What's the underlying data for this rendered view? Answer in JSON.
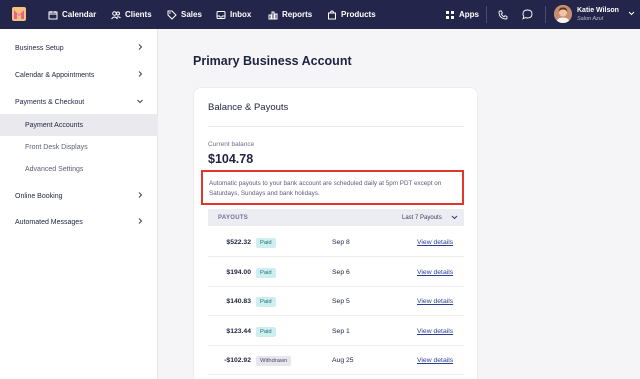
{
  "nav": {
    "items": [
      {
        "label": "Calendar",
        "icon": "calendar-icon"
      },
      {
        "label": "Clients",
        "icon": "clients-icon"
      },
      {
        "label": "Sales",
        "icon": "tag-icon"
      },
      {
        "label": "Inbox",
        "icon": "inbox-icon"
      },
      {
        "label": "Reports",
        "icon": "reports-icon"
      },
      {
        "label": "Products",
        "icon": "bag-icon"
      }
    ],
    "apps_label": "Apps",
    "user_name": "Katie Wilson",
    "user_business": "Salon Azul"
  },
  "sidebar": {
    "items": [
      {
        "label": "Business Setup"
      },
      {
        "label": "Calendar & Appointments"
      },
      {
        "label": "Payments & Checkout"
      },
      {
        "label": "Online Booking"
      },
      {
        "label": "Automated Messages"
      }
    ],
    "subitems": [
      {
        "label": "Payment Accounts"
      },
      {
        "label": "Front Desk Displays"
      },
      {
        "label": "Advanced Settings"
      }
    ]
  },
  "main": {
    "page_title": "Primary Business Account",
    "card_title": "Balance & Payouts",
    "balance_label": "Current balance",
    "balance_value": "$104.78",
    "payout_note": "Automatic payouts to your bank account are scheduled daily at 5pm PDT except on Saturdays, Sundays and bank holidays.",
    "payouts_header": "PAYOUTS",
    "payouts_filter": "Last 7 Payouts",
    "payouts": [
      {
        "amount": "$522.32",
        "status": "Paid",
        "date": "Sep 8",
        "link": "View details"
      },
      {
        "amount": "$194.00",
        "status": "Paid",
        "date": "Sep 6",
        "link": "View details"
      },
      {
        "amount": "$140.83",
        "status": "Paid",
        "date": "Sep 5",
        "link": "View details"
      },
      {
        "amount": "$123.44",
        "status": "Paid",
        "date": "Sep 1",
        "link": "View details"
      },
      {
        "amount": "-$102.92",
        "status": "Withdrawn",
        "date": "Aug 25",
        "link": "View details"
      }
    ]
  },
  "colors": {
    "nav_bg": "#23264a",
    "highlight_border": "#e1362b",
    "paid_badge": "#cfeef0",
    "link": "#2a3d8f"
  }
}
